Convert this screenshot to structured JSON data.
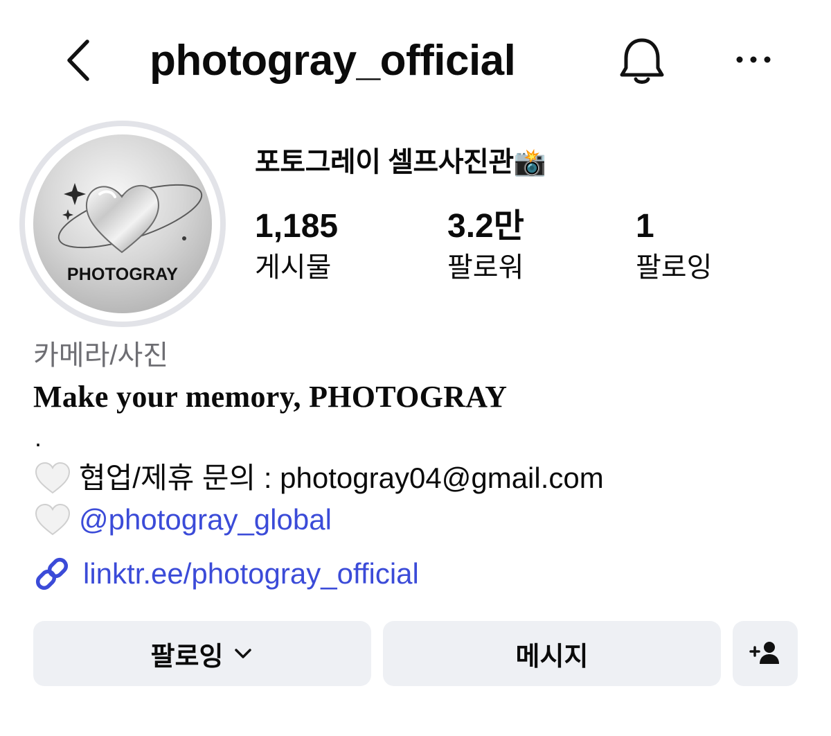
{
  "header": {
    "username": "photogray_official"
  },
  "profile": {
    "avatar_text": "PHOTOGRAY",
    "display_name": "포토그레이 셀프사진관",
    "display_name_emoji": "📸"
  },
  "stats": [
    {
      "value": "1,185",
      "label": "게시물"
    },
    {
      "value": "3.2만",
      "label": "팔로워"
    },
    {
      "value": "1",
      "label": "팔로잉"
    }
  ],
  "bio": {
    "category": "카메라/사진",
    "tagline": "Make your memory, PHOTOGRAY",
    "dot": ".",
    "contact_line": "협업/제휴 문의 : photogray04@gmail.com",
    "mention": "@photogray_global",
    "link": "linktr.ee/photogray_official"
  },
  "actions": {
    "follow_label": "팔로잉",
    "message_label": "메시지"
  },
  "colors": {
    "link_blue": "#3b4bd8",
    "button_bg": "#eef0f4",
    "secondary_text": "#6e6e73"
  },
  "icons": [
    "back-chevron-icon",
    "bell-icon",
    "more-icon",
    "heart-icon",
    "link-icon",
    "chevron-down-icon",
    "add-person-icon"
  ]
}
